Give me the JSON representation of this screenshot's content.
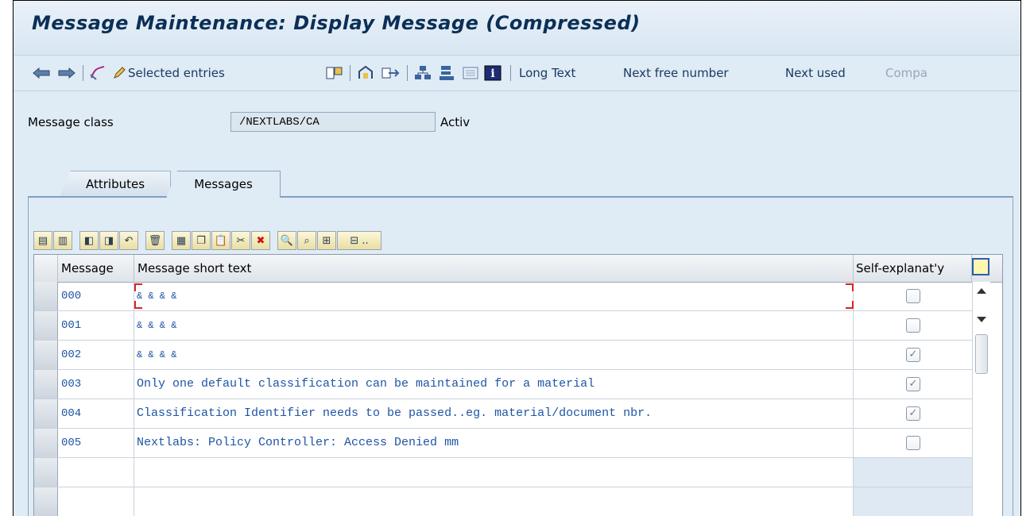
{
  "window": {
    "title": "Message Maintenance: Display Message (Compressed)"
  },
  "toolbar": {
    "selected_entries": "Selected entries",
    "long_text": "Long Text",
    "next_free_number": "Next free number",
    "next_used": "Next used",
    "compare": "Compa"
  },
  "header": {
    "message_class_label": "Message class",
    "message_class_value": "/NEXTLABS/CA",
    "status": "Activ"
  },
  "tabs": [
    {
      "label": "Attributes",
      "active": false
    },
    {
      "label": "Messages",
      "active": true
    }
  ],
  "grid": {
    "columns": [
      "Message",
      "Message short text",
      "Self-explanat'y"
    ],
    "rows": [
      {
        "number": "000",
        "text": "& & & &",
        "self_explanatory": false
      },
      {
        "number": "001",
        "text": "& & & &",
        "self_explanatory": false
      },
      {
        "number": "002",
        "text": "& & & &",
        "self_explanatory": true
      },
      {
        "number": "003",
        "text": "Only one default classification can be maintained for a material",
        "self_explanatory": true
      },
      {
        "number": "004",
        "text": "Classification Identifier needs to be passed..eg. material/document nbr.",
        "self_explanatory": true
      },
      {
        "number": "005",
        "text": "Nextlabs: Policy Controller: Access Denied mm",
        "self_explanatory": false
      }
    ]
  },
  "colors": {
    "accent": "#1e55a5",
    "background": "#dfebf5",
    "title": "#0b2f57"
  }
}
